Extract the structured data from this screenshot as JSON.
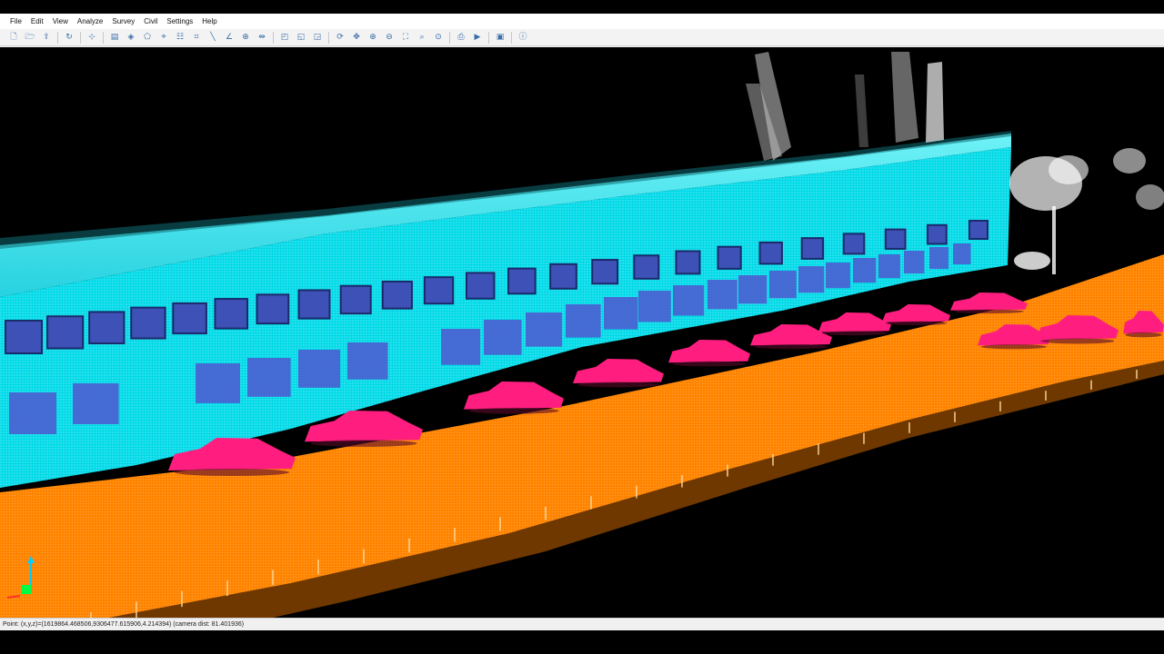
{
  "menu": [
    "File",
    "Edit",
    "View",
    "Analyze",
    "Survey",
    "Civil",
    "Settings",
    "Help"
  ],
  "toolbar_icons": [
    {
      "name": "new-icon",
      "glyph": "🗋"
    },
    {
      "name": "open-icon",
      "glyph": "🗁"
    },
    {
      "name": "export-icon",
      "glyph": "⇪"
    },
    {
      "sep": true
    },
    {
      "name": "refresh-icon",
      "glyph": "↻"
    },
    {
      "sep": true
    },
    {
      "name": "axes-icon",
      "glyph": "⊹"
    },
    {
      "sep": true
    },
    {
      "name": "layers-icon",
      "glyph": "▤"
    },
    {
      "name": "select-icon",
      "glyph": "◈"
    },
    {
      "name": "polygon-icon",
      "glyph": "⬠"
    },
    {
      "name": "lasso-icon",
      "glyph": "⌖"
    },
    {
      "name": "filter-icon",
      "glyph": "☷"
    },
    {
      "name": "clip-icon",
      "glyph": "⌗"
    },
    {
      "name": "measure-line-icon",
      "glyph": "╲"
    },
    {
      "name": "measure-angle-icon",
      "glyph": "∠"
    },
    {
      "name": "info-point-icon",
      "glyph": "⊕"
    },
    {
      "name": "cross-section-icon",
      "glyph": "⇹"
    },
    {
      "sep": true
    },
    {
      "name": "view-iso-icon",
      "glyph": "◰"
    },
    {
      "name": "view-front-icon",
      "glyph": "◱"
    },
    {
      "name": "view-top-icon",
      "glyph": "◲"
    },
    {
      "sep": true
    },
    {
      "name": "rotate-icon",
      "glyph": "⟳"
    },
    {
      "name": "pan-icon",
      "glyph": "✥"
    },
    {
      "name": "zoom-in-icon",
      "glyph": "⊕"
    },
    {
      "name": "zoom-out-icon",
      "glyph": "⊖"
    },
    {
      "name": "zoom-extent-icon",
      "glyph": "⛶"
    },
    {
      "name": "zoom-window-icon",
      "glyph": "⌕"
    },
    {
      "name": "zoom-previous-icon",
      "glyph": "⊙"
    },
    {
      "sep": true
    },
    {
      "name": "camera-icon",
      "glyph": "⎙"
    },
    {
      "name": "play-icon",
      "glyph": "▶"
    },
    {
      "sep": true
    },
    {
      "name": "screenshot-icon",
      "glyph": "▣"
    },
    {
      "sep": true
    },
    {
      "name": "help-icon",
      "glyph": "ⓘ"
    }
  ],
  "status": {
    "text": "Point: (x,y,z)=(1619864.468506,9306477.615906,4.214394)  (camera dist: 81.401936)"
  },
  "colors": {
    "facade": "#00e5f0",
    "roof": "#22d6e8",
    "ground": "#ff8a00",
    "cars": "#ff1e7f",
    "windows": "#4a5fd0",
    "vegetation": "#ffffff",
    "axis_y": "#00d0ff",
    "axis_z": "#00ff40"
  }
}
